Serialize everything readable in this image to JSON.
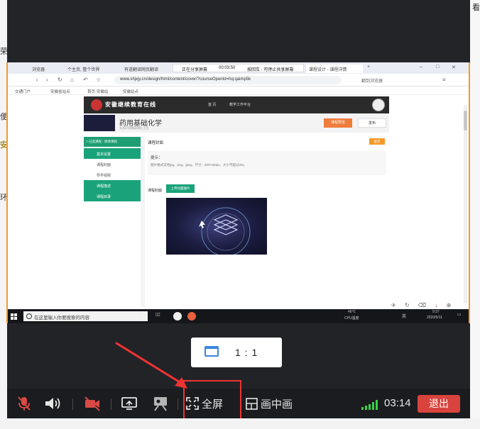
{
  "background": {
    "left_marks": [
      "荣",
      "便",
      "安",
      "环"
    ],
    "right_glyph": "看"
  },
  "shared_window": {
    "browser_tabs": [
      "浏览器",
      "个主页, 整个世界",
      "有道翻译网页翻译",
      "课程设计 - 课程详情"
    ],
    "recording_bar": {
      "label": "正在分享屏幕",
      "time": "00:03:50",
      "action": "按回车 - 可停止共享屏幕"
    },
    "address": "www.shjxjy.cn/design/html/content/cover/?courseOpenId=hq:qaimp5k",
    "address_search": "翻到浏览器",
    "bookmarks": [
      "交通门户",
      "安徽省站点",
      "首页-安徽站",
      "安徽站点"
    ],
    "site_name": "安徽继续教育在线",
    "site_nav": [
      "首 页",
      "教学工作平台"
    ],
    "course_title": "药用基础化学",
    "course_subtitle": "交流环境基础课程-主页",
    "course_buttons": {
      "primary": "课程预览",
      "secondary": "发布"
    },
    "sidebar_top": "□ 已选课程 - 修改课程",
    "sidebar_items": [
      {
        "label": "基本设置",
        "style": "green"
      },
      {
        "label": "课程封面",
        "style": "white"
      },
      {
        "label": "导学视频",
        "style": "white"
      },
      {
        "label": "课程描述",
        "style": "green"
      },
      {
        "label": "课程目录",
        "style": "green"
      }
    ],
    "panel_heading": "课程封面",
    "panel_tag": "提交",
    "section_title": "提示：",
    "section_text": "图片格式支持jpg、png、jpeg，尺寸：800*450px，大小不超过2M。",
    "cover_label": "课程封面",
    "upload_button": "上传封面图片",
    "taskbar": {
      "search_placeholder": "在这里输入你要搜索的内容",
      "weather": "46℃",
      "cpu": "CPU温度",
      "lang": "英",
      "clock_time": "9:37",
      "clock_date": "2020/5/11"
    }
  },
  "ratio_popup": {
    "label": "1 : 1"
  },
  "toolbar": {
    "fullscreen_label": "全屏",
    "pip_label": "画中画",
    "duration": "03:14",
    "exit_label": "退出"
  },
  "colors": {
    "accent_green": "#1aa37a",
    "exit_red": "#d9433d",
    "highlight_red": "#ee3333",
    "share_border": "#f39a2b",
    "signal_green": "#3bd14a"
  }
}
